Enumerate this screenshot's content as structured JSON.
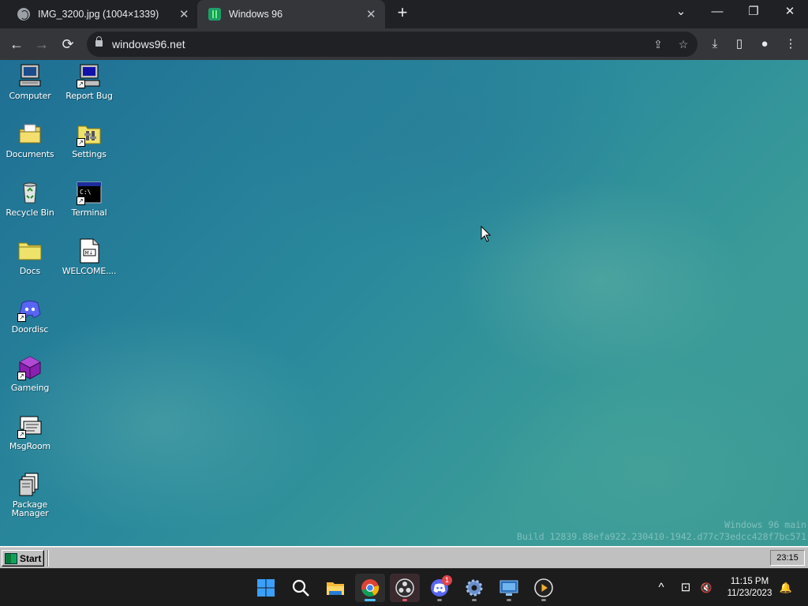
{
  "browser": {
    "tabs": [
      {
        "title": "IMG_3200.jpg (1004×1339)",
        "active": false
      },
      {
        "title": "Windows 96",
        "active": true
      }
    ],
    "new_tab": "+",
    "close_glyph": "✕",
    "url": "windows96.net",
    "window_controls": {
      "caret": "⌄",
      "minimize": "—",
      "restore": "❐",
      "close": "✕"
    },
    "nav": {
      "back": "←",
      "forward": "→",
      "reload": "⟳"
    },
    "toolbar_icons": [
      "share-icon",
      "bookmark-star-icon",
      "download-icon",
      "side-panel-icon",
      "profile-icon",
      "menu-icon"
    ],
    "glyphs": {
      "share": "⇪",
      "star": "☆",
      "download": "⤓",
      "panel": "▯",
      "profile": "●",
      "menu": "⋮"
    }
  },
  "desktop": {
    "icons_col1": [
      {
        "label": "Computer",
        "icon": "computer-icon",
        "shortcut": false
      },
      {
        "label": "Documents",
        "icon": "documents-folder-icon",
        "shortcut": false
      },
      {
        "label": "Recycle Bin",
        "icon": "recycle-bin-icon",
        "shortcut": false
      },
      {
        "label": "Docs",
        "icon": "folder-icon",
        "shortcut": false
      },
      {
        "label": "Doordisc",
        "icon": "discord-icon",
        "shortcut": true
      },
      {
        "label": "Gameing",
        "icon": "cube-icon",
        "shortcut": true
      },
      {
        "label": "MsgRoom",
        "icon": "msgroom-icon",
        "shortcut": true
      },
      {
        "label": "Package Manager",
        "icon": "package-icon",
        "shortcut": false
      }
    ],
    "icons_col2": [
      {
        "label": "Report Bug",
        "icon": "report-bug-icon",
        "shortcut": true
      },
      {
        "label": "Settings",
        "icon": "settings-icon",
        "shortcut": true
      },
      {
        "label": "Terminal",
        "icon": "terminal-icon",
        "shortcut": true
      },
      {
        "label": "WELCOME....",
        "icon": "markdown-file-icon",
        "shortcut": false
      }
    ],
    "build_line1": "Windows 96 main",
    "build_line2": "Build 12839.88efa922.230410-1942.d77c73edcc428f7bc571"
  },
  "w96_taskbar": {
    "start_label": "Start",
    "clock": "23:15"
  },
  "win11_taskbar": {
    "apps": [
      {
        "name": "start-icon",
        "active": false,
        "running": false
      },
      {
        "name": "search-icon",
        "active": false,
        "running": false
      },
      {
        "name": "file-explorer-icon",
        "active": false,
        "running": false
      },
      {
        "name": "chrome-icon",
        "active": true,
        "running": true
      },
      {
        "name": "obs-icon",
        "active": false,
        "running": true
      },
      {
        "name": "discord-icon",
        "active": false,
        "running": true,
        "badge": "1"
      },
      {
        "name": "settings-icon",
        "active": false,
        "running": true
      },
      {
        "name": "screen-icon",
        "active": false,
        "running": true
      },
      {
        "name": "media-player-icon",
        "active": false,
        "running": true
      }
    ],
    "time": "11:15 PM",
    "date": "11/23/2023",
    "tray": {
      "chevron": "^",
      "network": "⊡",
      "volume": "🔇",
      "notifications": "🔔"
    }
  },
  "colors": {
    "accent": "#4cc2ff",
    "desktop_base": "#2a8a9c",
    "w96_gray": "#c0c0c0"
  }
}
